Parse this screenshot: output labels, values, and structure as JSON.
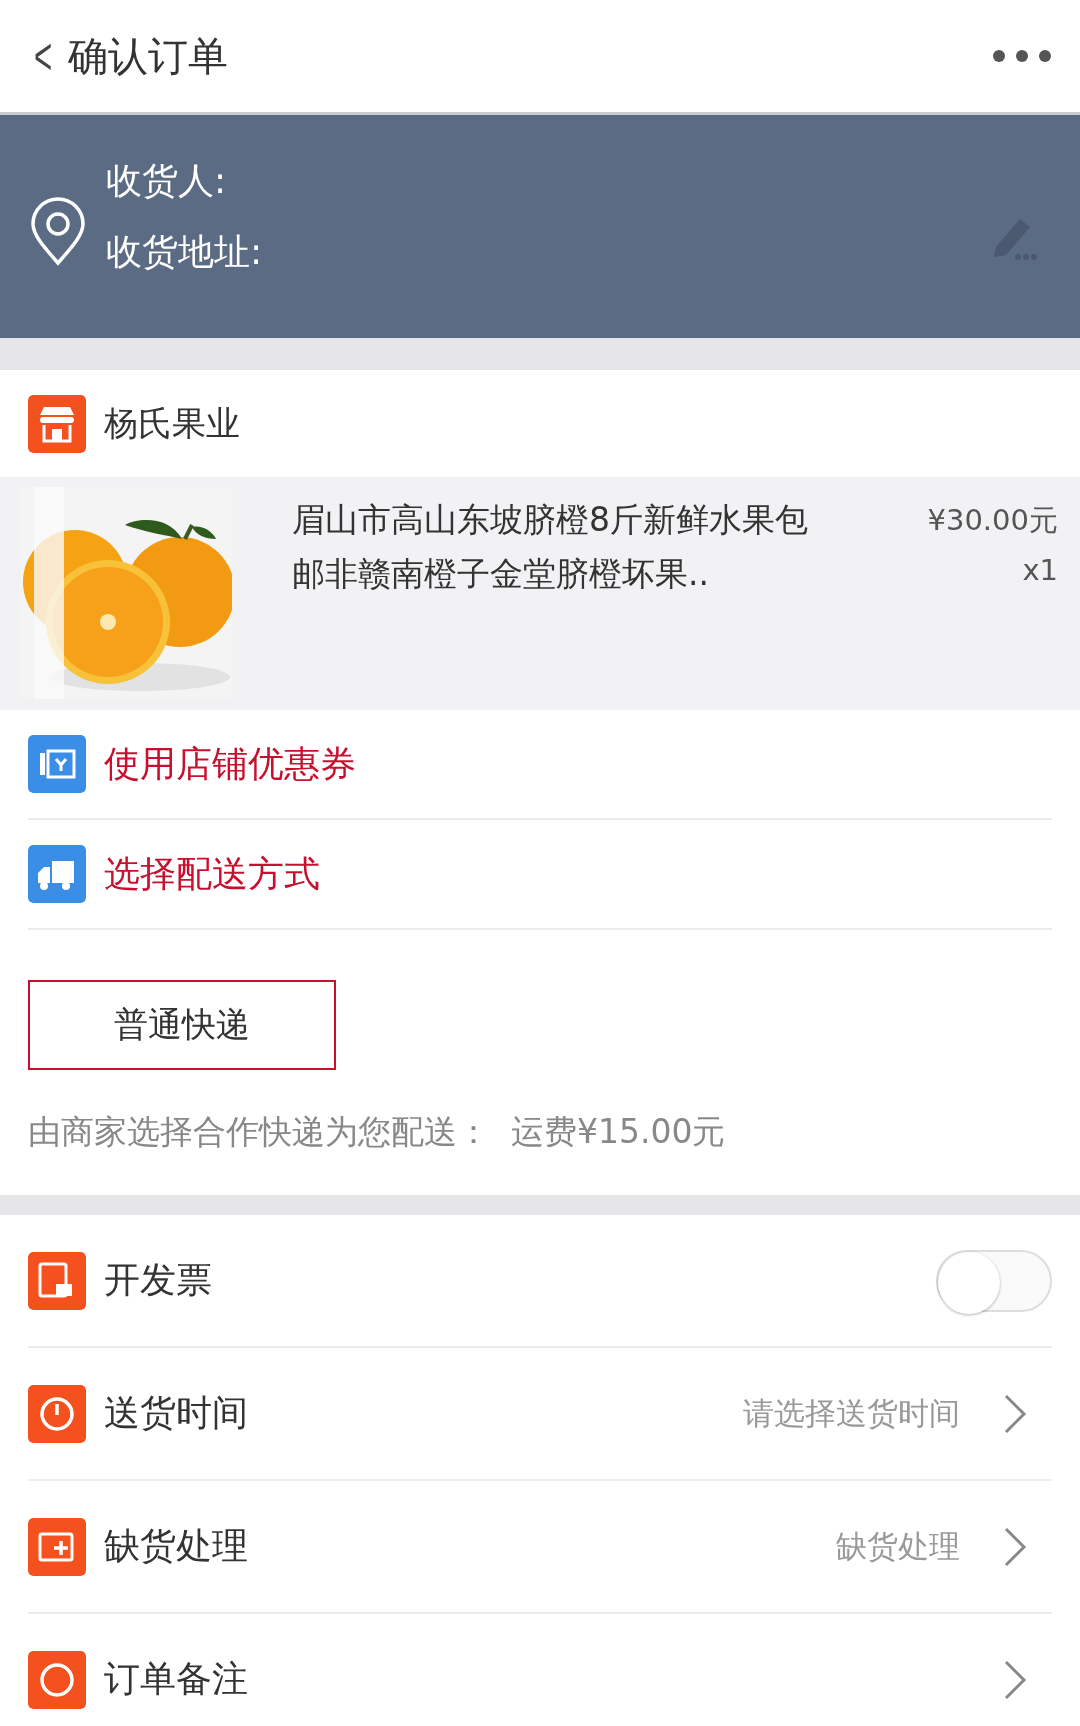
{
  "header": {
    "back": "<",
    "title": "确认订单"
  },
  "address": {
    "recipient_label": "收货人:",
    "address_label": "收货地址:"
  },
  "store": {
    "name": "杨氏果业"
  },
  "product": {
    "title": "眉山市高山东坡脐橙8斤新鲜水果包邮非赣南橙子金堂脐橙坏果..",
    "price": "¥30.00元",
    "quantity": "x1"
  },
  "options": [
    {
      "label": "使用店铺优惠券"
    },
    {
      "label": "选择配送方式"
    }
  ],
  "shipping": {
    "methods": [
      {
        "label": "普通快递",
        "selected": true
      }
    ],
    "note": "由商家选择合作快递为您配送：  运费¥15.00元"
  },
  "rows": [
    {
      "kind": "toggle",
      "label": "开发票",
      "on": false
    },
    {
      "kind": "link",
      "label": "送货时间",
      "value": "请选择送货时间"
    },
    {
      "kind": "link",
      "label": "缺货处理",
      "value": "缺货处理"
    },
    {
      "kind": "link",
      "label": "订单备注"
    }
  ]
}
